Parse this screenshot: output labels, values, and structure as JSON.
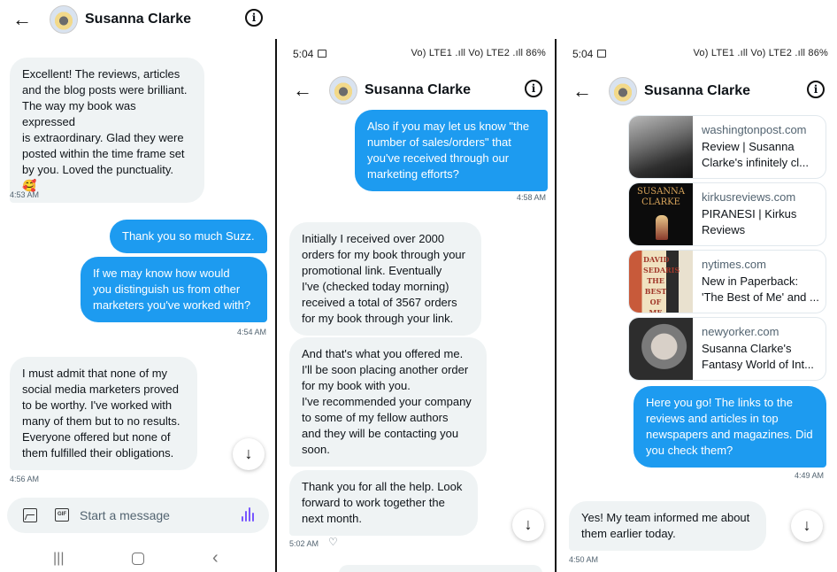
{
  "contact_name": "Susanna Clarke",
  "colors": {
    "outgoing_bubble": "#1d9bf0",
    "incoming_bubble": "#eff3f4",
    "voice_accent": "#7856ff"
  },
  "panel1": {
    "messages": [
      {
        "dir": "in",
        "text": "Excellent! The reviews, articles\nand the blog posts were brilliant.\nThe way my book was expressed\nis extraordinary. Glad they were\nposted within the time frame set\nby you. Loved the punctuality.\n🥰"
      },
      {
        "dir": "out",
        "text": "Thank you so much Suzz."
      },
      {
        "dir": "out",
        "text": "If we may know how would\nyou distinguish us from other\nmarketers you've worked with?"
      },
      {
        "dir": "in",
        "text": "I must admit that none of my\nsocial media marketers proved\nto be worthy. I've worked with\nmany of them but to no results.\nEveryone offered but none of\nthem fulfilled their obligations."
      }
    ],
    "timestamps": [
      "4:53 AM",
      "4:54 AM",
      "4:56 AM"
    ],
    "composer_placeholder": "Start a message",
    "composer_gif_label": "GIF"
  },
  "panel2": {
    "status_time": "5:04",
    "status_right": "Vo) LTE1 .ıll Vo) LTE2 .ıll 86%",
    "messages": [
      {
        "dir": "out",
        "text": "Also if you may let us know \"the\nnumber of sales/orders\" that\nyou've received through our\nmarketing efforts?"
      },
      {
        "dir": "in",
        "text": "Initially I received over 2000\norders for my book through your\npromotional link. Eventually\nI've (checked today morning)\nreceived a total of 3567 orders\nfor my book through your link."
      },
      {
        "dir": "in",
        "text": "And that's what you offered me.\nI'll be soon placing another order\nfor my book with you.\nI've recommended your company\nto some of my fellow authors\nand they will be contacting you\nsoon."
      },
      {
        "dir": "in",
        "text": "Thank you for all the help. Look\nforward to work together the\nnext month."
      }
    ],
    "timestamps": [
      "4:58 AM",
      "5:02 AM"
    ]
  },
  "panel3": {
    "status_time": "5:04",
    "status_right": "Vo) LTE1 .ıll Vo) LTE2 .ıll 86%",
    "links": [
      {
        "domain": "washingtonpost.com",
        "title": "Review | Susanna Clarke's infinitely cl..."
      },
      {
        "domain": "kirkusreviews.com",
        "title": "PIRANESI | Kirkus Reviews",
        "thumb_text": "SUSANNA\nCLARKE"
      },
      {
        "domain": "nytimes.com",
        "title": "New in Paperback: 'The Best of Me' and ...",
        "thumb_text": "DAVID\nSEDARIS\nTHE\nBEST\nOF ME"
      },
      {
        "domain": "newyorker.com",
        "title": "Susanna Clarke's Fantasy World of Int..."
      }
    ],
    "messages": [
      {
        "dir": "out",
        "text": "Here you go! The links to the\nreviews and articles in top\nnewspapers and magazines. Did\nyou check them?"
      },
      {
        "dir": "in",
        "text": "Yes! My team informed me about\nthem earlier today."
      }
    ],
    "timestamps": [
      "4:49 AM",
      "4:50 AM"
    ]
  }
}
